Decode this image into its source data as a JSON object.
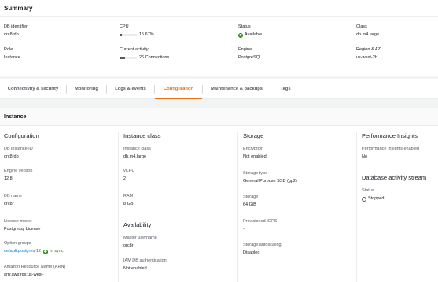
{
  "summary": {
    "title": "Summary",
    "db_identifier": {
      "label": "DB identifier",
      "value": "orc8rdb"
    },
    "cpu": {
      "label": "CPU",
      "value": "15.67%",
      "fraction": 0.1567
    },
    "status": {
      "label": "Status",
      "value": "Available"
    },
    "class": {
      "label": "Class",
      "value": "db.m4.large"
    },
    "role": {
      "label": "Role",
      "value": "Instance"
    },
    "current_activity": {
      "label": "Current activity",
      "value": "26 Connections",
      "fraction": 0.3
    },
    "engine": {
      "label": "Engine",
      "value": "PostgreSQL"
    },
    "region": {
      "label": "Region & AZ",
      "value": "us-west-2b"
    }
  },
  "tabs": [
    {
      "label": "Connectivity & security"
    },
    {
      "label": "Monitoring"
    },
    {
      "label": "Logs & events"
    },
    {
      "label": "Configuration"
    },
    {
      "label": "Maintenance & backups"
    },
    {
      "label": "Tags"
    }
  ],
  "instance": {
    "title": "Instance",
    "configuration": {
      "title": "Configuration",
      "db_instance_id": {
        "label": "DB instance ID",
        "value": "orc8rdb"
      },
      "engine_version": {
        "label": "Engine version",
        "value": "12.8"
      },
      "db_name": {
        "label": "DB name",
        "value": "orc8r"
      },
      "license_model": {
        "label": "License model",
        "value": "Postgresql License"
      },
      "option_groups": {
        "label": "Option groups",
        "value": "default:postgres-12",
        "sync": "In sync"
      },
      "arn": {
        "label": "Amazon Resource Name (ARN)",
        "value": "arn:aws:rds:us-west-"
      }
    },
    "instance_class": {
      "title": "Instance class",
      "instance_class": {
        "label": "Instance class",
        "value": "db.m4.large"
      },
      "vcpu": {
        "label": "vCPU",
        "value": "2"
      },
      "ram": {
        "label": "RAM",
        "value": "8 GB"
      }
    },
    "availability": {
      "title": "Availability",
      "master_username": {
        "label": "Master username",
        "value": "orc8r"
      },
      "iam_auth": {
        "label": "IAM DB authentication",
        "value": "Not enabled"
      }
    },
    "storage": {
      "title": "Storage",
      "encryption": {
        "label": "Encryption",
        "value": "Not enabled"
      },
      "storage_type": {
        "label": "Storage type",
        "value": "General Purpose SSD (gp2)"
      },
      "storage": {
        "label": "Storage",
        "value": "64 GiB"
      },
      "iops": {
        "label": "Provisioned IOPS",
        "value": "-"
      },
      "autoscaling": {
        "label": "Storage autoscaling",
        "value": "Disabled"
      }
    },
    "performance_insights": {
      "title": "Performance Insights",
      "enabled": {
        "label": "Performance Insights enabled",
        "value": "No"
      }
    },
    "activity_stream": {
      "title": "Database activity stream",
      "status": {
        "label": "Status",
        "value": "Stopped"
      }
    }
  },
  "colors": {
    "accent": "#ec7211",
    "success": "#1d8102",
    "link": "#0073bb"
  },
  "icons": [
    "check-circle-icon",
    "stopped-icon"
  ]
}
